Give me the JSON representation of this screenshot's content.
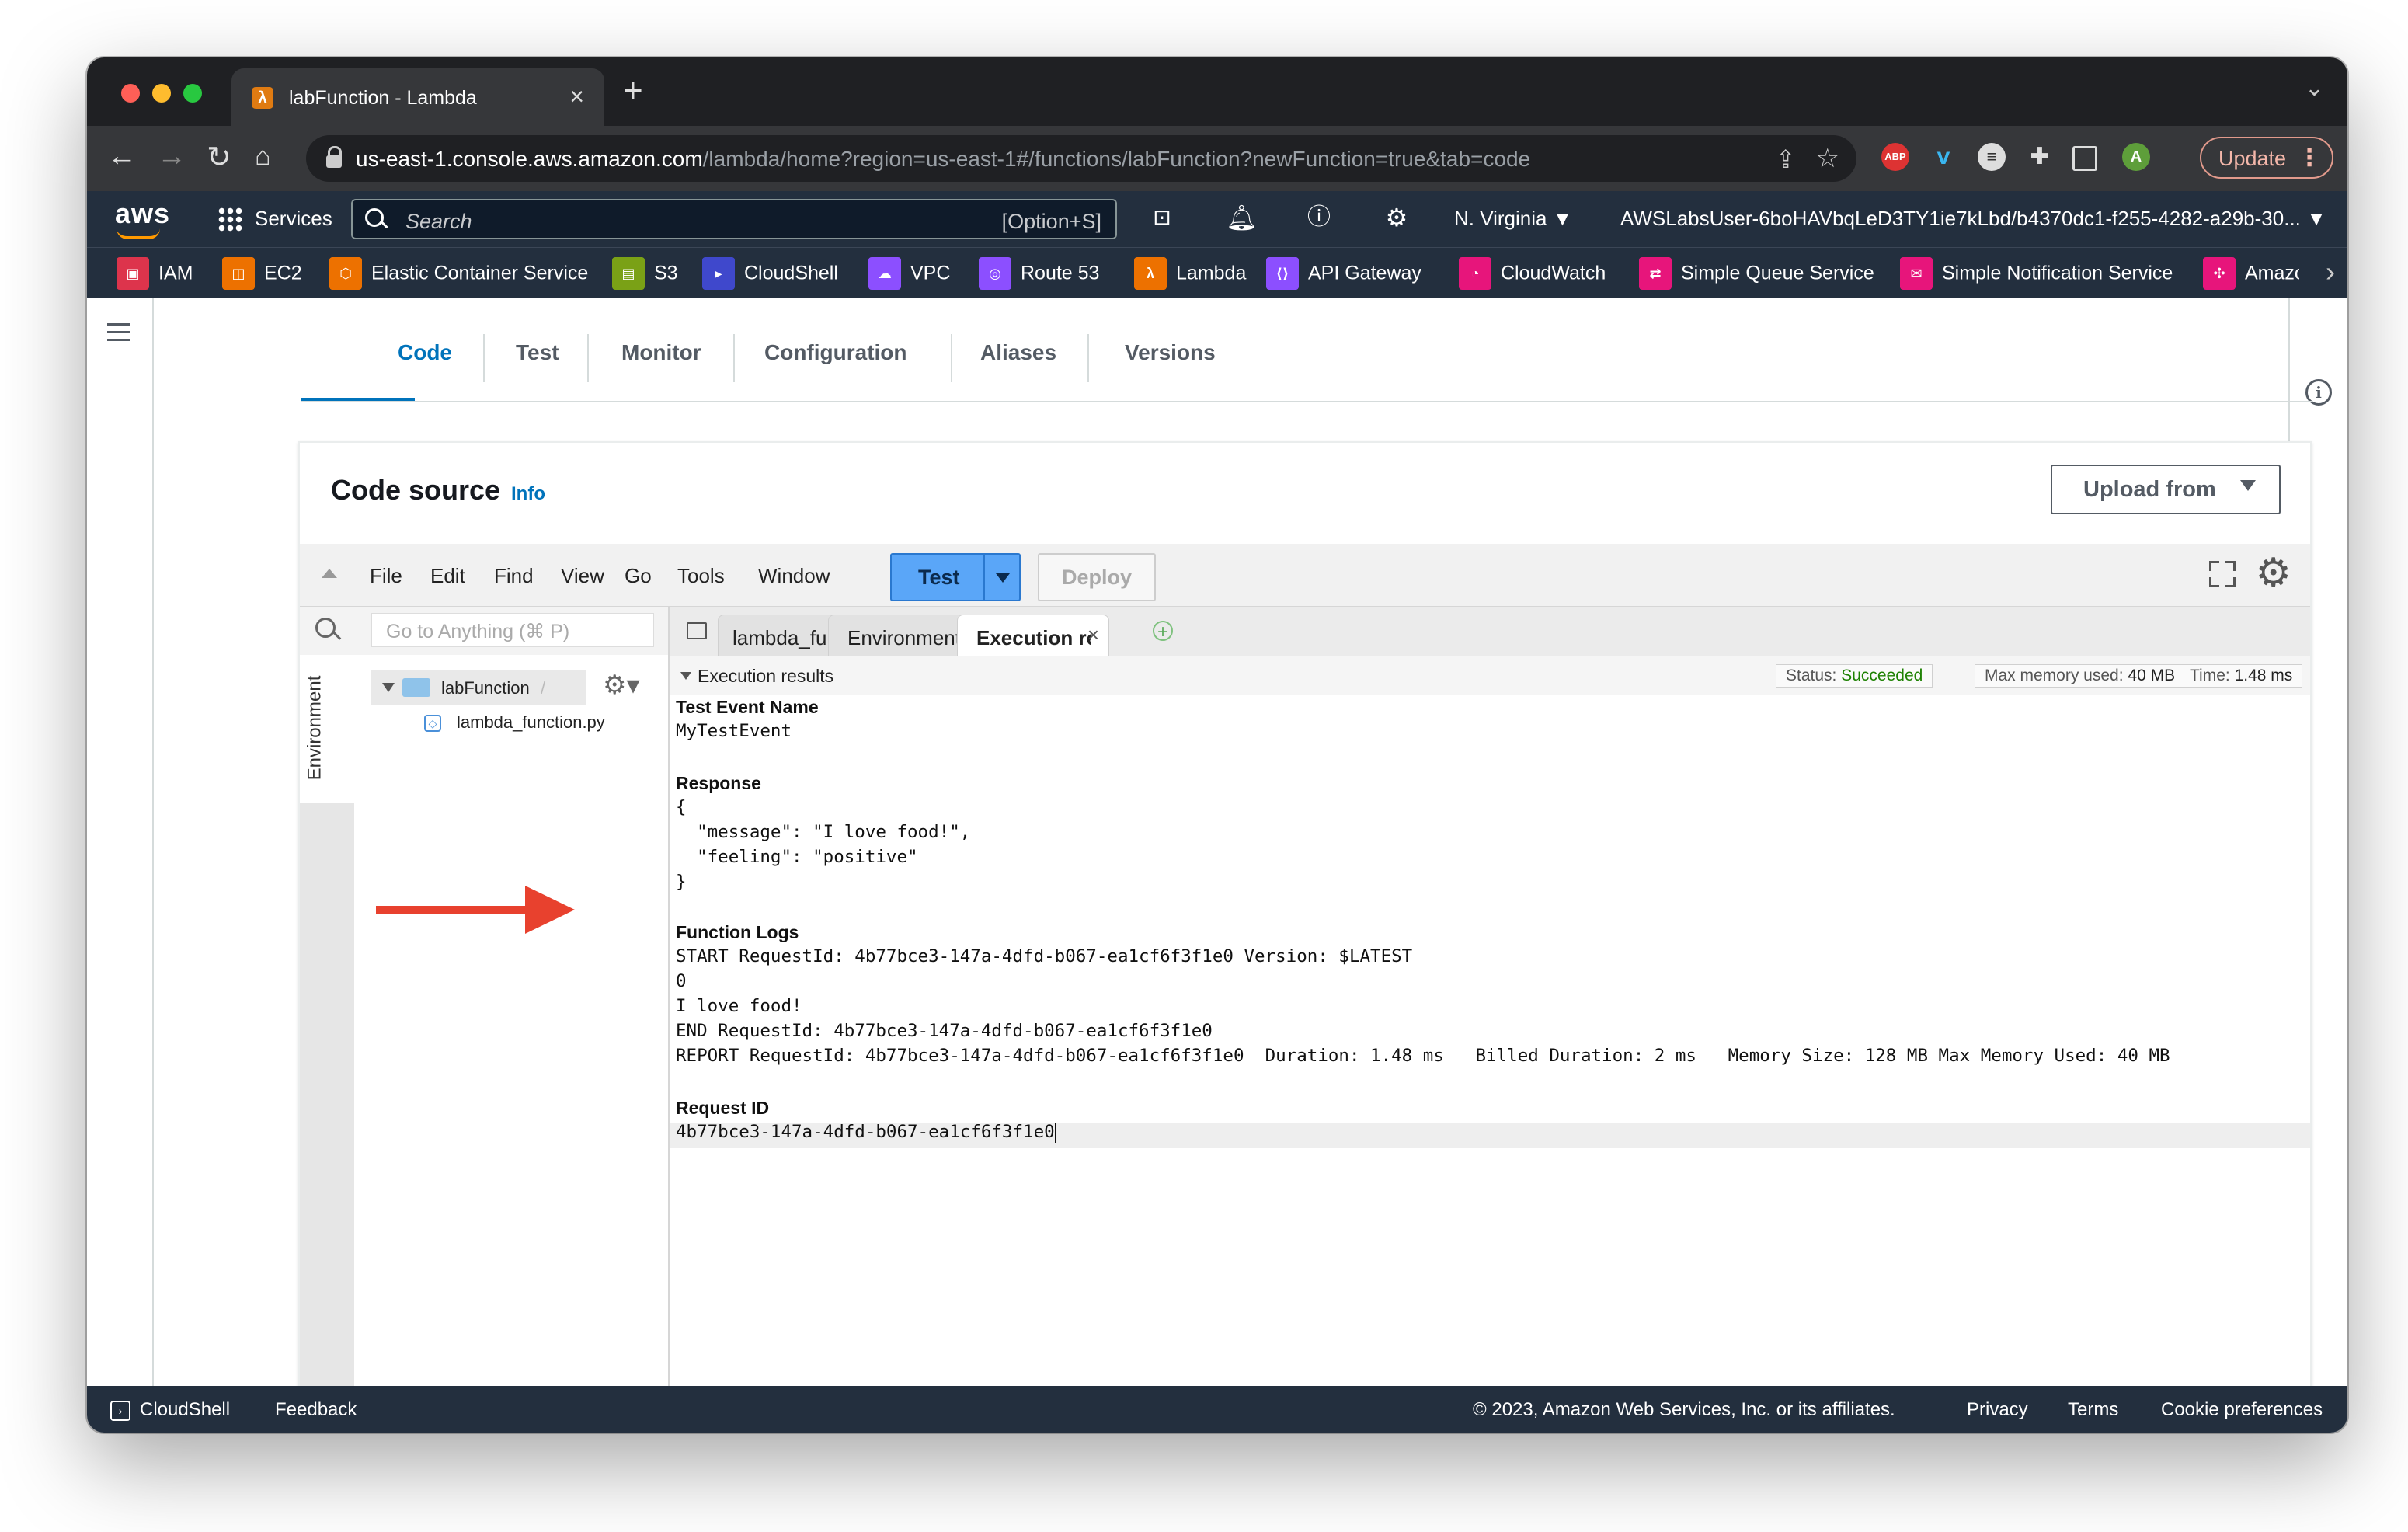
{
  "browser": {
    "tab_title": "labFunction - Lambda",
    "url_host": "us-east-1.console.aws.amazon.com",
    "url_path": "/lambda/home?region=us-east-1#/functions/labFunction?newFunction=true&tab=code",
    "update_label": "Update",
    "profile_initial": "A"
  },
  "aws_nav": {
    "logo": "aws",
    "services_label": "Services",
    "search_placeholder": "Search",
    "search_shortcut": "[Option+S]",
    "region": "N. Virginia ▼",
    "account": "AWSLabsUser-6boHAVbqLeD3TY1ie7kLbd/b4370dc1-f255-4282-a29b-30... ▼"
  },
  "favorites": [
    {
      "label": "IAM",
      "color": "#dd344c"
    },
    {
      "label": "EC2",
      "color": "#ed7100"
    },
    {
      "label": "Elastic Container Service",
      "color": "#ed7100"
    },
    {
      "label": "S3",
      "color": "#7aa116"
    },
    {
      "label": "CloudShell",
      "color": "#3f48cc"
    },
    {
      "label": "VPC",
      "color": "#8c4fff"
    },
    {
      "label": "Route 53",
      "color": "#8c4fff"
    },
    {
      "label": "Lambda",
      "color": "#ed7100"
    },
    {
      "label": "API Gateway",
      "color": "#8c4fff"
    },
    {
      "label": "CloudWatch",
      "color": "#e7157b"
    },
    {
      "label": "Simple Queue Service",
      "color": "#e7157b"
    },
    {
      "label": "Simple Notification Service",
      "color": "#e7157b"
    },
    {
      "label": "Amazon",
      "color": "#e7157b"
    }
  ],
  "function_tabs": [
    "Code",
    "Test",
    "Monitor",
    "Configuration",
    "Aliases",
    "Versions"
  ],
  "code_source": {
    "title": "Code source",
    "info": "Info",
    "upload_label": "Upload from"
  },
  "ide": {
    "menu": [
      "File",
      "Edit",
      "Find",
      "View",
      "Go",
      "Tools",
      "Window"
    ],
    "test_label": "Test",
    "deploy_label": "Deploy",
    "goto_placeholder": "Go to Anything (⌘ P)",
    "env_label": "Environment",
    "folder": "labFunction",
    "folder_sep": "/",
    "file": "lambda_function.py",
    "tabs": [
      {
        "label": "lambda_function.",
        "active": false
      },
      {
        "label": "Environment Vari",
        "active": false
      },
      {
        "label": "Execution result:",
        "active": true
      }
    ],
    "exec_header": "Execution results",
    "status_label": "Status:",
    "status_value": "Succeeded",
    "memory_label": "Max memory used:",
    "memory_value": "40 MB",
    "time_label": "Time:",
    "time_value": "1.48 ms"
  },
  "results": {
    "test_event_label": "Test Event Name",
    "test_event_name": "MyTestEvent",
    "response_label": "Response",
    "response_lines": [
      "{",
      "  \"message\": \"I love food!\",",
      "  \"feeling\": \"positive\"",
      "}"
    ],
    "logs_label": "Function Logs",
    "log_lines": [
      "START RequestId: 4b77bce3-147a-4dfd-b067-ea1cf6f3f1e0 Version: $LATEST",
      "0",
      "I love food!",
      "END RequestId: 4b77bce3-147a-4dfd-b067-ea1cf6f3f1e0",
      "REPORT RequestId: 4b77bce3-147a-4dfd-b067-ea1cf6f3f1e0  Duration: 1.48 ms   Billed Duration: 2 ms   Memory Size: 128 MB Max Memory Used: 40 MB"
    ],
    "request_id_label": "Request ID",
    "request_id": "4b77bce3-147a-4dfd-b067-ea1cf6f3f1e0"
  },
  "footer": {
    "cloudshell": "CloudShell",
    "feedback": "Feedback",
    "copyright": "© 2023, Amazon Web Services, Inc. or its affiliates.",
    "privacy": "Privacy",
    "terms": "Terms",
    "cookies": "Cookie preferences"
  }
}
